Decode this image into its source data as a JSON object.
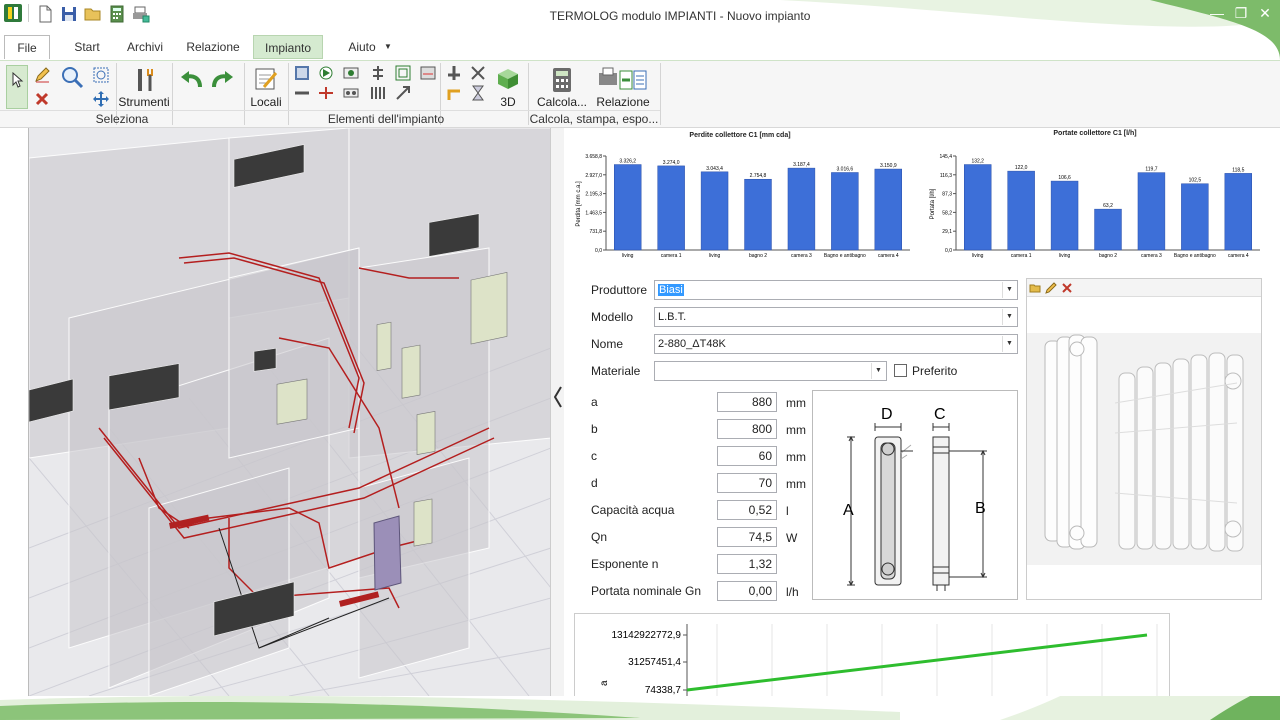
{
  "window": {
    "title": "TERMOLOG modulo IMPIANTI  - Nuovo impianto",
    "minimize_glyph": "—",
    "restore_glyph": "❐",
    "close_glyph": "✕"
  },
  "tabs": [
    {
      "label": "File"
    },
    {
      "label": "Start"
    },
    {
      "label": "Archivi"
    },
    {
      "label": "Relazione"
    },
    {
      "label": "Impianto"
    },
    {
      "label": "Aiuto"
    }
  ],
  "ribbon": {
    "tools_label": "Strumenti",
    "locali_label": "Locali",
    "view3d_label": "3D",
    "calcola_label": "Calcola...",
    "relazione_label": "Relazione",
    "groups": {
      "seleziona": "Seleziona",
      "elementi": "Elementi dell'impianto",
      "calcola": "Calcola, stampa, espo..."
    }
  },
  "form": {
    "produttore": {
      "label": "Produttore",
      "value": "Biasi"
    },
    "modello": {
      "label": "Modello",
      "value": "L.B.T."
    },
    "nome": {
      "label": "Nome",
      "value": "2-880_ΔT48K"
    },
    "materiale": {
      "label": "Materiale",
      "value": ""
    },
    "preferito": {
      "label": "Preferito",
      "checked": false
    },
    "params": [
      {
        "label": "a",
        "value": "880",
        "unit": "mm"
      },
      {
        "label": "b",
        "value": "800",
        "unit": "mm"
      },
      {
        "label": "c",
        "value": "60",
        "unit": "mm"
      },
      {
        "label": "d",
        "value": "70",
        "unit": "mm"
      },
      {
        "label": "Capacità acqua",
        "value": "0,52",
        "unit": "l"
      },
      {
        "label": "Qn",
        "value": "74,5",
        "unit": "W"
      },
      {
        "label": "Esponente n",
        "value": "1,32",
        "unit": ""
      },
      {
        "label": "Portata nominale Gn",
        "value": "0,00",
        "unit": "l/h"
      }
    ]
  },
  "diagram": {
    "A": "A",
    "B": "B",
    "C": "C",
    "D": "D"
  },
  "accent": "#3d6fd8",
  "chart_data": [
    {
      "type": "bar",
      "title": "Perdite collettore C1 [mm cda]",
      "ylabel": "Perdita [mm c.a.]",
      "categories": [
        "living",
        "camera 1",
        "living",
        "bagno 2",
        "camera 3",
        "Bagno e antibagno",
        "camera 4"
      ],
      "values": [
        3326.2,
        3274.0,
        3043.4,
        2754.8,
        3187.4,
        3016.6,
        3150.9
      ],
      "value_labels": [
        "3.326,2",
        "3.274,0",
        "3.043,4",
        "2.754,8",
        "3.187,4",
        "3.016,6",
        "3.150,9"
      ],
      "yticks": [
        "3.658,8",
        "2.927,0",
        "2.195,3",
        "1.463,5",
        "731,8",
        "0,0"
      ],
      "ylim": [
        0,
        3658.8
      ]
    },
    {
      "type": "bar",
      "title": "Portate collettore C1 [l/h]",
      "ylabel": "Portata [l/h]",
      "categories": [
        "living",
        "camera 1",
        "living",
        "bagno 2",
        "camera 3",
        "Bagno e antibagno",
        "camera 4"
      ],
      "values": [
        132.2,
        122.0,
        106.6,
        63.2,
        119.7,
        102.5,
        118.5
      ],
      "value_labels": [
        "132,2",
        "122,0",
        "106,6",
        "63,2",
        "119,7",
        "102,5",
        "118,5"
      ],
      "yticks": [
        "145,4",
        "116,3",
        "87,3",
        "58,2",
        "29,1",
        "0,0"
      ],
      "ylim": [
        0,
        145.4
      ]
    },
    {
      "type": "line",
      "yticks": [
        "13142922772,9",
        "31257451,4",
        "74338,7"
      ],
      "ylabel": "a",
      "scale": "log",
      "series": [
        {
          "values": [
            74338.7,
            13142922772.9
          ]
        }
      ]
    }
  ]
}
